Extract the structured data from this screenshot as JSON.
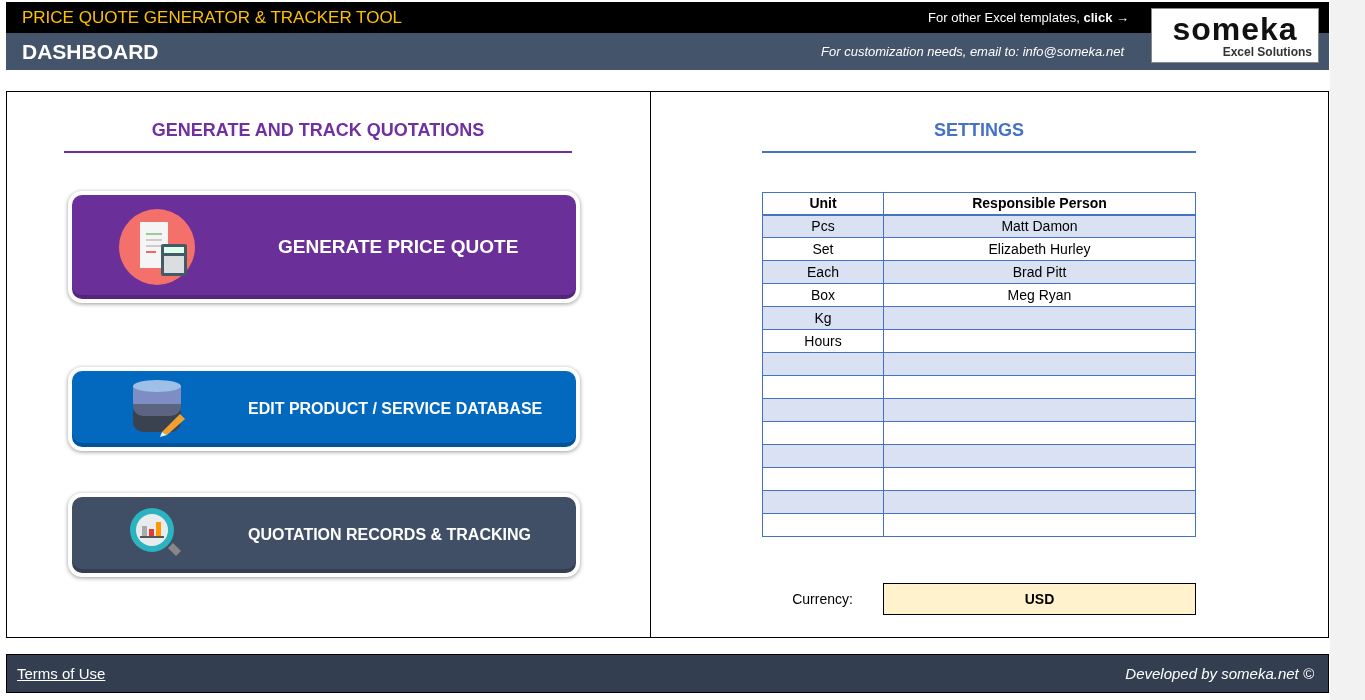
{
  "header": {
    "title": "PRICE QUOTE GENERATOR & TRACKER TOOL",
    "subtitle": "DASHBOARD",
    "templates_text": "For other Excel templates, **click** →",
    "customization_text": "For customization needs, email to: info@someka.net",
    "logo": {
      "name": "someka",
      "tagline": "Excel Solutions"
    }
  },
  "left": {
    "heading": "GENERATE AND TRACK QUOTATIONS",
    "buttons": [
      {
        "label": "GENERATE PRICE QUOTE",
        "kind": "receipt",
        "color": "#6b2f9a"
      },
      {
        "label": "EDIT PRODUCT / SERVICE DATABASE",
        "kind": "database",
        "color": "#0269be"
      },
      {
        "label": "QUOTATION RECORDS & TRACKING",
        "kind": "search-chart",
        "color": "#414f66"
      }
    ]
  },
  "settings": {
    "heading": "SETTINGS",
    "columns": [
      "Unit",
      "Responsible Person"
    ],
    "rows": [
      {
        "unit": "Pcs",
        "person": "Matt Damon"
      },
      {
        "unit": "Set",
        "person": "Elizabeth Hurley"
      },
      {
        "unit": "Each",
        "person": "Brad Pitt"
      },
      {
        "unit": "Box",
        "person": "Meg Ryan"
      },
      {
        "unit": "Kg"
      },
      {
        "unit": "Hours"
      },
      {},
      {},
      {},
      {},
      {},
      {},
      {},
      {}
    ],
    "currency_label": "Currency:",
    "currency": "USD"
  },
  "footer": {
    "link": "Terms of Use",
    "credit": "Developed by someka.net ©"
  }
}
